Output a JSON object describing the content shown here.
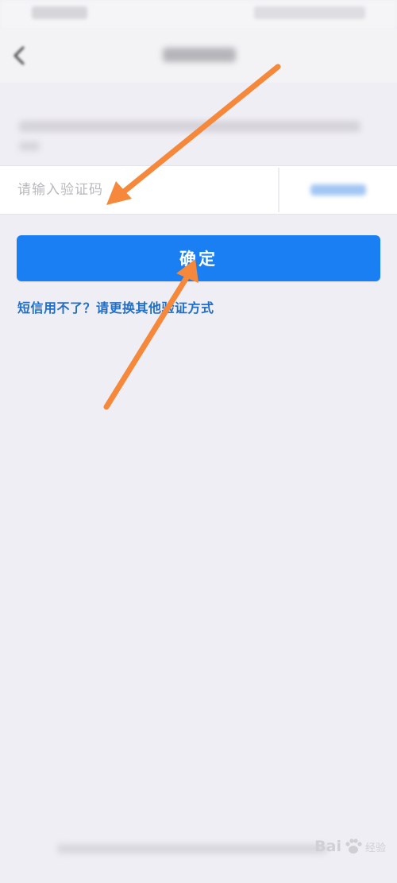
{
  "input": {
    "placeholder": "请输入验证码"
  },
  "confirm": {
    "label": "确定"
  },
  "alt_link": {
    "label": "短信用不了？请更换其他验证方式"
  },
  "watermark": {
    "brand": "Bai",
    "sub": "经验"
  },
  "colors": {
    "accent": "#1a7ff2",
    "link": "#1f6fc8",
    "arrow": "#f5883a",
    "background": "#efeef4"
  }
}
